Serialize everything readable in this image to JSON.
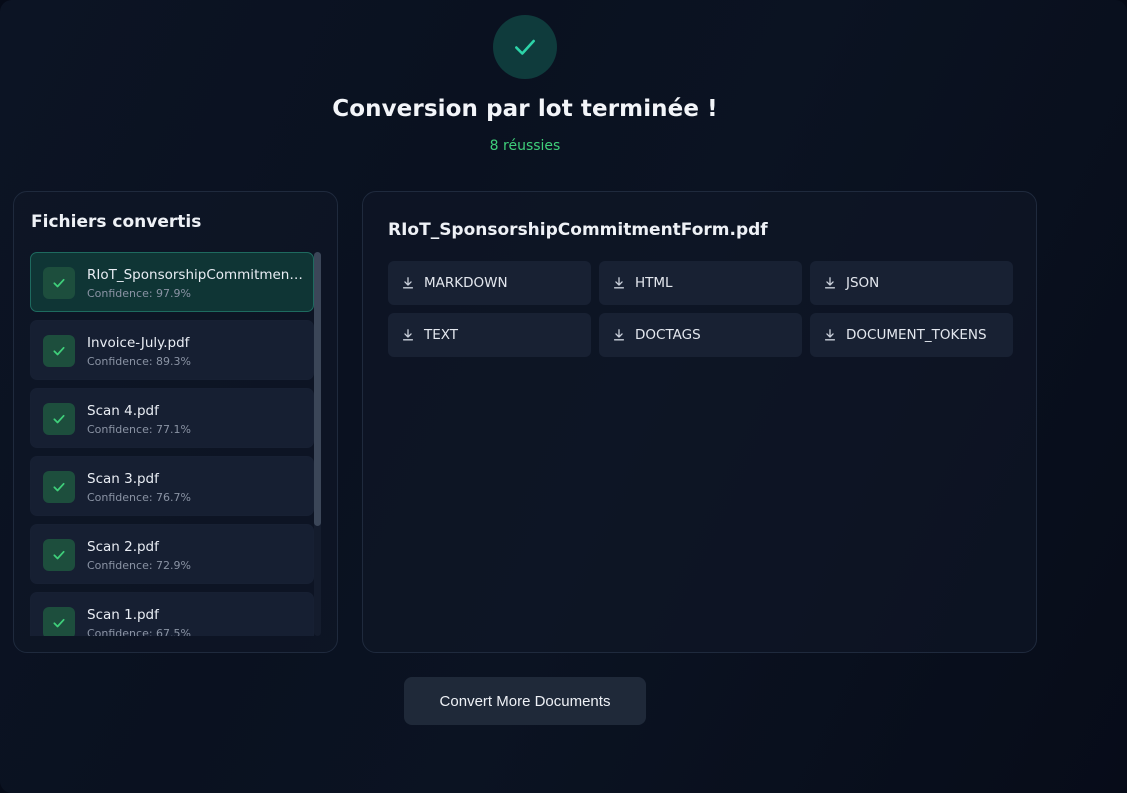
{
  "header": {
    "title": "Conversion par lot terminée !",
    "subtitle": "8 réussies"
  },
  "files_panel": {
    "title": "Fichiers convertis",
    "items": [
      {
        "name": "RIoT_SponsorshipCommitmentForm.pdf",
        "confidence": "Confidence: 97.9%",
        "active": true
      },
      {
        "name": "Invoice-July.pdf",
        "confidence": "Confidence: 89.3%"
      },
      {
        "name": "Scan 4.pdf",
        "confidence": "Confidence: 77.1%"
      },
      {
        "name": "Scan 3.pdf",
        "confidence": "Confidence: 76.7%"
      },
      {
        "name": "Scan 2.pdf",
        "confidence": "Confidence: 72.9%"
      },
      {
        "name": "Scan 1.pdf",
        "confidence": "Confidence: 67.5%"
      }
    ]
  },
  "detail_panel": {
    "document_title": "RIoT_SponsorshipCommitmentForm.pdf",
    "formats": [
      "MARKDOWN",
      "HTML",
      "JSON",
      "TEXT",
      "DOCTAGS",
      "DOCUMENT_TOKENS"
    ]
  },
  "footer": {
    "convert_more_label": "Convert More Documents"
  },
  "colors": {
    "success_green": "#3fcf7a",
    "accent_teal": "#2dd4a8",
    "background": "#060b18"
  },
  "icons": {
    "success": "check-icon",
    "file_status": "check-icon",
    "format": "download-icon"
  }
}
